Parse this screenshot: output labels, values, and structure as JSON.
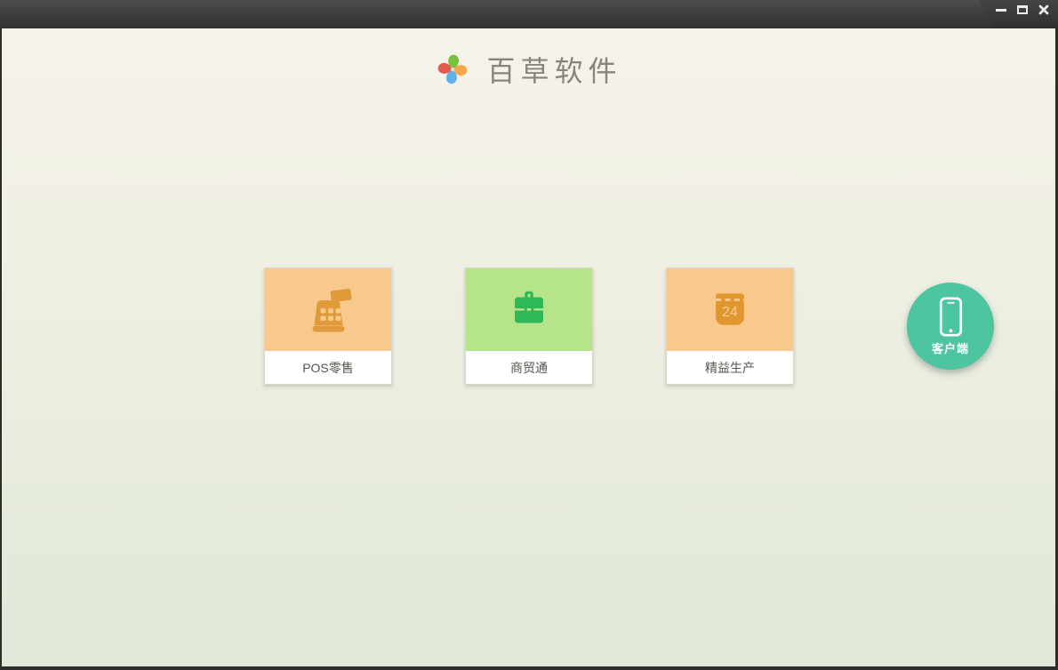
{
  "window": {
    "controls": [
      {
        "name": "minimize"
      },
      {
        "name": "maximize"
      },
      {
        "name": "close"
      }
    ]
  },
  "header": {
    "app_name": "百草软件",
    "logo": {
      "name": "pinwheel-logo",
      "petal_colors": {
        "top": "#79c13f",
        "right": "#f4a74b",
        "bottom": "#62b1e8",
        "left": "#e15a4b"
      }
    }
  },
  "products": [
    {
      "label": "POS零售",
      "icon": "cash-register-icon",
      "tile_bg": "#f8c88d",
      "icon_color": "#df9a3b"
    },
    {
      "label": "商贸通",
      "icon": "briefcase-icon",
      "tile_bg": "#b6e48a",
      "icon_color": "#2eb857"
    },
    {
      "label": "精益生产",
      "icon": "calendar-icon",
      "tile_bg": "#f8c88d",
      "icon_color": "#e2962e",
      "calendar_day": "24",
      "calendar_day_color": "#f5d09c"
    }
  ],
  "client_button": {
    "label": "客户端",
    "icon": "smartphone-icon",
    "bg_color": "#4cc5a0"
  },
  "theme": {
    "titlebar_top": "#4e4e4c",
    "titlebar_bottom": "#333331",
    "frame_border": "#2c2c2a",
    "page_bg_top": "#f6f3ea",
    "page_bg_bottom": "#dfe8d9",
    "card_label_color": "#55544e",
    "card_border": "#dbd8cb"
  }
}
